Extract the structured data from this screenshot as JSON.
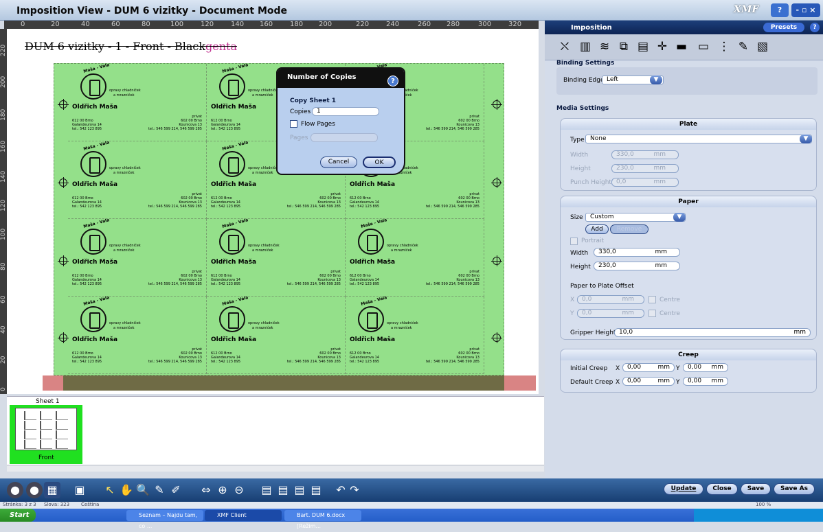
{
  "window": {
    "title": "Imposition View - DUM 6 vizitky - Document Mode",
    "brand": "XMF",
    "help_label": "?",
    "minmax_label": "- ▫ ×"
  },
  "ruler": {
    "marks": [
      "0",
      "20",
      "40",
      "60",
      "80",
      "100",
      "120",
      "140",
      "160",
      "180",
      "200",
      "220",
      "240",
      "260",
      "280",
      "300",
      "320"
    ],
    "v_marks": [
      "220",
      "200",
      "180",
      "160",
      "140",
      "120",
      "100",
      "80",
      "60",
      "40",
      "20",
      "0"
    ]
  },
  "sheet": {
    "label_prefix": "DUM 6 vizitky - 1 - Front - ",
    "label_overlap1": "Black",
    "label_overlap2": "genta"
  },
  "card": {
    "logo_arc": "Maša - Vala",
    "tagline1": "opravy chladniček",
    "tagline2": "a mrazniček",
    "name": "Oldřich Maša",
    "left_line1": "612 00 Brno",
    "left_line2": "Galandeurova 14",
    "left_line3": "tel.: 542 123 895",
    "right_line0": "privat",
    "right_line1": "602 00 Brno",
    "right_line2": "Kounicova 13",
    "right_line3": "tel.: 546 599 214, 546 599 285"
  },
  "dialog": {
    "title": "Number of Copies",
    "help": "?",
    "subtitle": "Copy Sheet 1",
    "copies_label": "Copies",
    "copies_value": "1",
    "flow_label": "Flow Pages",
    "pages_label": "Pages",
    "cancel": "Cancel",
    "ok": "OK"
  },
  "sheets_panel": {
    "sheet_name": "Sheet 1",
    "side": "Front"
  },
  "right_panel": {
    "header": "Imposition",
    "presets": "Presets",
    "help": "?",
    "binding": {
      "title": "Binding Settings",
      "edge_label": "Binding Edge",
      "edge_value": "Left"
    },
    "media": {
      "title": "Media Settings"
    },
    "plate": {
      "title": "Plate",
      "type_label": "Type",
      "type_value": "None",
      "width_label": "Width",
      "width_value": "330,0",
      "height_label": "Height",
      "height_value": "230,0",
      "punch_label": "Punch Height",
      "punch_value": "0,0",
      "unit": "mm"
    },
    "paper": {
      "title": "Paper",
      "size_label": "Size",
      "size_value": "Custom",
      "add": "Add",
      "remove": "Remove",
      "portrait": "Portrait",
      "width_label": "Width",
      "width_value": "330,0",
      "height_label": "Height",
      "height_value": "230,0",
      "offset_label": "Paper to Plate Offset",
      "x_label": "X",
      "x_value": "0,0",
      "y_label": "Y",
      "y_value": "0,0",
      "centre": "Centre",
      "gripper_label": "Gripper Height",
      "gripper_value": "10,0",
      "unit": "mm"
    },
    "creep": {
      "title": "Creep",
      "initial_label": "Initial Creep",
      "default_label": "Default Creep",
      "x": "X",
      "y": "Y",
      "ix": "0,00",
      "iy": "0,00",
      "dx": "0,00",
      "dy": "0,00",
      "unit": "mm"
    },
    "buttons": {
      "update": "Update",
      "close": "Close",
      "save": "Save",
      "save_as": "Save As"
    }
  },
  "statusbar": {
    "page": "Stránka: 3 z 3",
    "words": "Slova: 323",
    "lang": "Čeština",
    "zoom": "100 %"
  },
  "taskbar": {
    "start": "Start",
    "tasks": [
      "Seznam – Najdu tam, co ...",
      "XMF Client",
      "Bart. DUM 6.docx [Režim..."
    ]
  },
  "colors": {
    "plate_green": "#94e08a",
    "thumb_green": "#20e020",
    "accent_blue": "#173e72"
  }
}
